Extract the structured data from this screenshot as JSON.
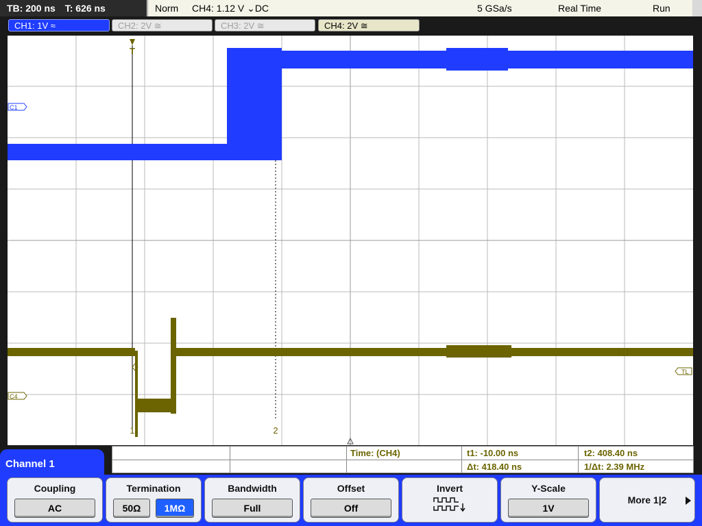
{
  "status": {
    "timebase": "TB: 200 ns",
    "trigger_time": "T: 626 ns",
    "mode": "Norm",
    "trigger": "CH4: 1.12 V ⌄DC",
    "sample_rate": "5 GSa/s",
    "acq_mode": "Real Time",
    "run_state": "Run"
  },
  "channels": [
    {
      "label": "CH1: 1V ≈",
      "active": true
    },
    {
      "label": "CH2: 2V ≅",
      "active": false
    },
    {
      "label": "CH3: 2V ≅",
      "active": false
    },
    {
      "label": "CH4: 2V ≅",
      "active": true
    }
  ],
  "markers": {
    "trigger": "T",
    "c1": "C1",
    "c4": "C4",
    "tl": "TL",
    "cursor1": "1",
    "cursor2": "2"
  },
  "colors": {
    "ch1": "#1f3cff",
    "ch4": "#6b6400",
    "grid": "#b8b8b8",
    "softbar": "#1f3cff"
  },
  "measurements": {
    "source": "Time:  (CH4)",
    "t1": "t1: -10.00 ns",
    "t2": "t2: 408.40 ns",
    "delta_t": "Δt: 418.40 ns",
    "inv_delta_t": "1/Δt: 2.39 MHz"
  },
  "menu": {
    "title": "Channel 1",
    "coupling": {
      "label": "Coupling",
      "value": "AC"
    },
    "termination": {
      "label": "Termination",
      "opt1": "50Ω",
      "opt2": "1MΩ",
      "selected": "1MΩ"
    },
    "bandwidth": {
      "label": "Bandwidth",
      "value": "Full"
    },
    "offset": {
      "label": "Offset",
      "value": "Off"
    },
    "invert": {
      "label": "Invert",
      "icon": "invert-waveform-icon"
    },
    "yscale": {
      "label": "Y-Scale",
      "value": "1V"
    },
    "more": {
      "label": "More 1|2"
    }
  }
}
